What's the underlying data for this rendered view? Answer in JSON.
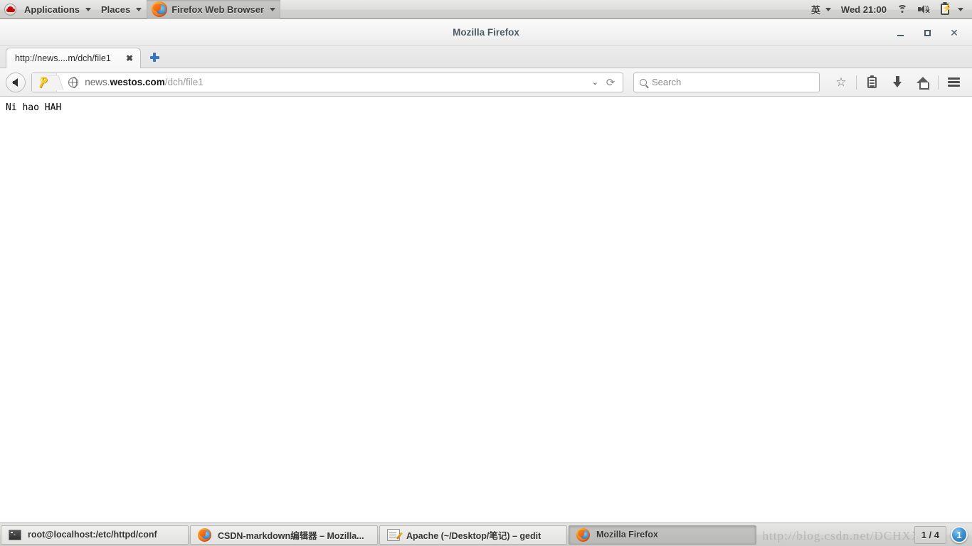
{
  "top_panel": {
    "logo_icon": "redhat-logo-icon",
    "menus": [
      {
        "label": "Applications",
        "name": "applications-menu"
      },
      {
        "label": "Places",
        "name": "places-menu"
      }
    ],
    "active_app": {
      "label": "Firefox Web Browser",
      "icon": "firefox-icon"
    },
    "input_method": "英",
    "clock": "Wed 21:00",
    "indicators": [
      {
        "name": "network-icon"
      },
      {
        "name": "volume-muted-icon"
      },
      {
        "name": "battery-charging-icon"
      }
    ]
  },
  "window": {
    "title": "Mozilla Firefox",
    "controls": {
      "minimize": "minimize-button",
      "maximize": "maximize-button",
      "close": "close-button"
    }
  },
  "tabs": [
    {
      "title": "http://news....m/dch/file1",
      "close_label": "✖",
      "active": true
    }
  ],
  "new_tab_label": "+",
  "navbar": {
    "back_label": "Back",
    "identity_icon": "key-icon",
    "site_icon": "globe-icon",
    "url": {
      "prefix": "news.",
      "domain": "westos.com",
      "path": "/dch/file1",
      "full": "news.westos.com/dch/file1"
    },
    "dropdown_label": "⌄",
    "reload_label": "⟳",
    "search_placeholder": "Search",
    "search_value": "",
    "icons": [
      {
        "name": "bookmark-star-icon",
        "label": "☆"
      },
      {
        "name": "library-icon",
        "label": ""
      },
      {
        "name": "downloads-icon",
        "label": ""
      },
      {
        "name": "home-icon",
        "label": ""
      },
      {
        "name": "hamburger-menu-icon",
        "label": ""
      }
    ]
  },
  "page": {
    "body_text": "Ni hao HAH"
  },
  "taskbar": {
    "items": [
      {
        "label": "root@localhost:/etc/httpd/conf",
        "icon": "terminal-icon",
        "active": false,
        "name": "taskbar-item-terminal"
      },
      {
        "label": "CSDN-markdown编辑器 – Mozilla...",
        "icon": "firefox-icon",
        "active": false,
        "name": "taskbar-item-csdn-firefox"
      },
      {
        "label": "Apache (~/Desktop/笔记) – gedit",
        "icon": "gedit-icon",
        "active": false,
        "name": "taskbar-item-gedit"
      },
      {
        "label": "Mozilla Firefox",
        "icon": "firefox-icon",
        "active": true,
        "name": "taskbar-item-firefox"
      }
    ],
    "workspace": "1 / 4",
    "notification_count": "1",
    "watermark": "http://blog.csdn.net/DCHXX"
  },
  "colors": {
    "accent_blue": "#3477c4",
    "panel_bg": "#dedede",
    "firefox_orange": "#f4701f",
    "redhat_red": "#cc0000"
  }
}
